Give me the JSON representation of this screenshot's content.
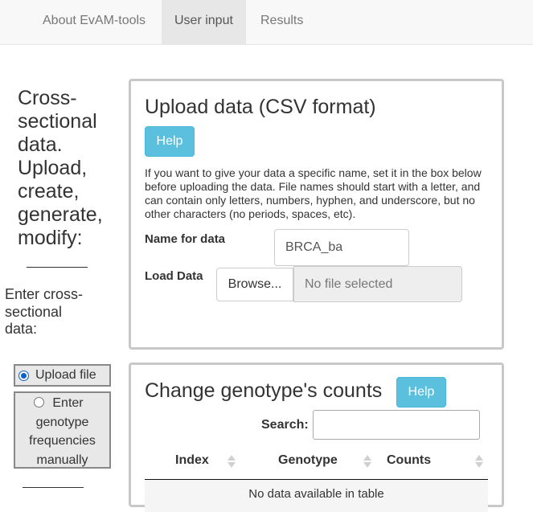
{
  "nav": {
    "tabs": [
      {
        "label": "About EvAM-tools",
        "active": false
      },
      {
        "label": "User input",
        "active": true
      },
      {
        "label": "Results",
        "active": false
      }
    ]
  },
  "sidebar": {
    "title": "Cross-sectional data. Upload, create, generate, modify:",
    "enter_label": "Enter cross-sectional data:",
    "options": [
      {
        "label": "Upload file",
        "selected": true
      },
      {
        "label": "Enter genotype frequencies manually",
        "selected": false
      }
    ]
  },
  "upload_panel": {
    "title": "Upload data (CSV format)",
    "help_label": "Help",
    "description": "If you want to give your data a specific name, set it in the box below before uploading the data. File names should start with a letter, and can contain only letters, numbers, hyphen, and underscore, but no other characters (no periods, spaces, etc).",
    "name_label": "Name for data",
    "name_value": "BRCA_ba",
    "load_label": "Load Data",
    "browse_label": "Browse...",
    "file_placeholder": "No file selected"
  },
  "counts_panel": {
    "title": "Change genotype's counts",
    "help_label": "Help",
    "search_label": "Search:",
    "search_value": "",
    "columns": [
      "Index",
      "Genotype",
      "Counts"
    ],
    "empty_message": "No data available in table"
  },
  "colors": {
    "help_button": "#5bc0de",
    "active_tab": "#e7e7e7",
    "radio_selected": "#0b62c4"
  }
}
